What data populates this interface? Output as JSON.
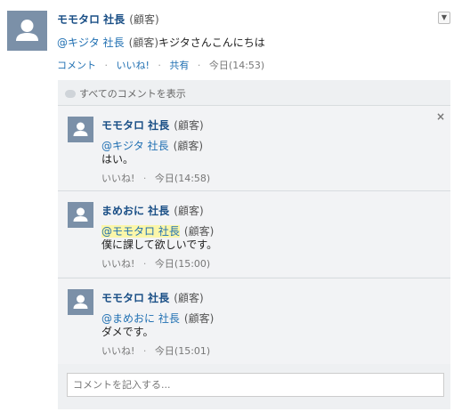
{
  "post": {
    "author": "モモタロ 社長",
    "role": "(顧客)",
    "mention": "@キジタ 社長",
    "mention_role": "(顧客)",
    "text": "キジタさんこんにちは",
    "actions": {
      "comment": "コメント",
      "like": "いいね!",
      "share": "共有"
    },
    "timestamp": "今日(14:53)",
    "dropdown_icon": "caret-down-icon"
  },
  "comments_section": {
    "show_all_label": "すべてのコメントを表示",
    "input_placeholder": "コメントを記入する...",
    "comments": [
      {
        "author": "モモタロ 社長",
        "role": "(顧客)",
        "mention": "@キジタ 社長",
        "mention_role": "(顧客)",
        "text": "はい。",
        "like_label": "いいね!",
        "timestamp": "今日(14:58)"
      },
      {
        "author": "まめおに 社長",
        "role": "(顧客)",
        "mention": "@モモタロ 社長",
        "mention_role": "(顧客)",
        "text": "僕に課して欲しいです。",
        "like_label": "いいね!",
        "timestamp": "今日(15:00)"
      },
      {
        "author": "モモタロ 社長",
        "role": "(顧客)",
        "mention": "@まめおに 社長",
        "mention_role": "(顧客)",
        "text": "ダメです。",
        "like_label": "いいね!",
        "timestamp": "今日(15:01)"
      }
    ],
    "close_symbol": "×"
  },
  "colors": {
    "name": "#1a4f86",
    "link": "#1f6fb2",
    "panel_bg": "#eef0f2",
    "avatar_bg": "#7b90a8",
    "highlight": "#fbf6a9"
  }
}
